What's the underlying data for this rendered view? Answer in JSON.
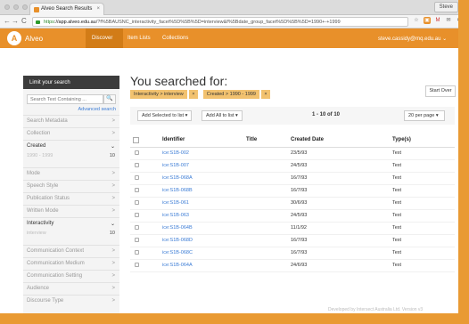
{
  "browser": {
    "tab_title": "Alveo Search Results",
    "tab_close": "×",
    "profile": "Steve",
    "url_https": "https",
    "url_host": "://app.alveo.edu.au",
    "url_path": "/?f%5BAUSNC_interactivity_facet%5D%5B%5D=interview&f%5Bdate_group_facet%5D%5B%5D=1990+-+1999",
    "back": "←",
    "forward": "→",
    "reload": "C",
    "home": "⌂",
    "ext_icons": [
      "☆",
      "▣",
      "M",
      "✉",
      "✱",
      "□",
      "≡"
    ]
  },
  "header": {
    "logo": "A",
    "brand": "Alveo",
    "nav": [
      "Discover",
      "Item Lists",
      "Collections"
    ],
    "user": "steve.cassidy@mq.edu.au ⌄"
  },
  "sidebar": {
    "title": "Limit your search",
    "search_placeholder": "Search Text Containing ...",
    "search_icon": "🔍",
    "advanced": "Advanced search",
    "facets_top": [
      {
        "label": "Search Metadata",
        "chev": ">"
      },
      {
        "label": "Collection",
        "chev": ">"
      }
    ],
    "created": {
      "label": "Created",
      "chev": "⌄",
      "value": "1990 - 1999",
      "count": "10"
    },
    "facets_mid": [
      {
        "label": "Mode",
        "chev": ">"
      },
      {
        "label": "Speech Style",
        "chev": ">"
      },
      {
        "label": "Publication Status",
        "chev": ">"
      },
      {
        "label": "Written Mode",
        "chev": ">"
      }
    ],
    "interactivity": {
      "label": "Interactivity",
      "chev": "⌄",
      "value": "interview",
      "count": "10"
    },
    "facets_bottom": [
      {
        "label": "Communication Context",
        "chev": ">"
      },
      {
        "label": "Communication Medium",
        "chev": ">"
      },
      {
        "label": "Communication Setting",
        "chev": ">"
      },
      {
        "label": "Audience",
        "chev": ">"
      },
      {
        "label": "Discourse Type",
        "chev": ">"
      }
    ]
  },
  "main": {
    "heading": "You searched for:",
    "chip1": "Interactivity > interview",
    "chip2": "Created > 1990 - 1999",
    "chip_remove": "×",
    "start_over": "Start Over",
    "add_selected": "Add Selected to list ▾",
    "add_all": "Add All to list ▾",
    "range": "1 - 10 of 10",
    "per_page": "20 per page ▾",
    "columns": [
      "Identifier",
      "Title",
      "Created Date",
      "Type(s)"
    ],
    "rows": [
      {
        "id": "ice:S1B-002",
        "title": "",
        "date": "23/5/93",
        "type": "Text"
      },
      {
        "id": "ice:S1B-007",
        "title": "",
        "date": "24/5/93",
        "type": "Text"
      },
      {
        "id": "ice:S1B-068A",
        "title": "",
        "date": "16/7/93",
        "type": "Text"
      },
      {
        "id": "ice:S1B-068B",
        "title": "",
        "date": "16/7/93",
        "type": "Text"
      },
      {
        "id": "ice:S1B-061",
        "title": "",
        "date": "30/6/93",
        "type": "Text"
      },
      {
        "id": "ice:S1B-063",
        "title": "",
        "date": "24/5/93",
        "type": "Text"
      },
      {
        "id": "ice:S1B-064B",
        "title": "",
        "date": "11/1/92",
        "type": "Text"
      },
      {
        "id": "ice:S1B-068D",
        "title": "",
        "date": "16/7/93",
        "type": "Text"
      },
      {
        "id": "ice:S1B-068C",
        "title": "",
        "date": "16/7/93",
        "type": "Text"
      },
      {
        "id": "ice:S1B-064A",
        "title": "",
        "date": "24/6/93",
        "type": "Text"
      }
    ],
    "footer": "Developed by Intersect Australia Ltd. Version v3"
  }
}
